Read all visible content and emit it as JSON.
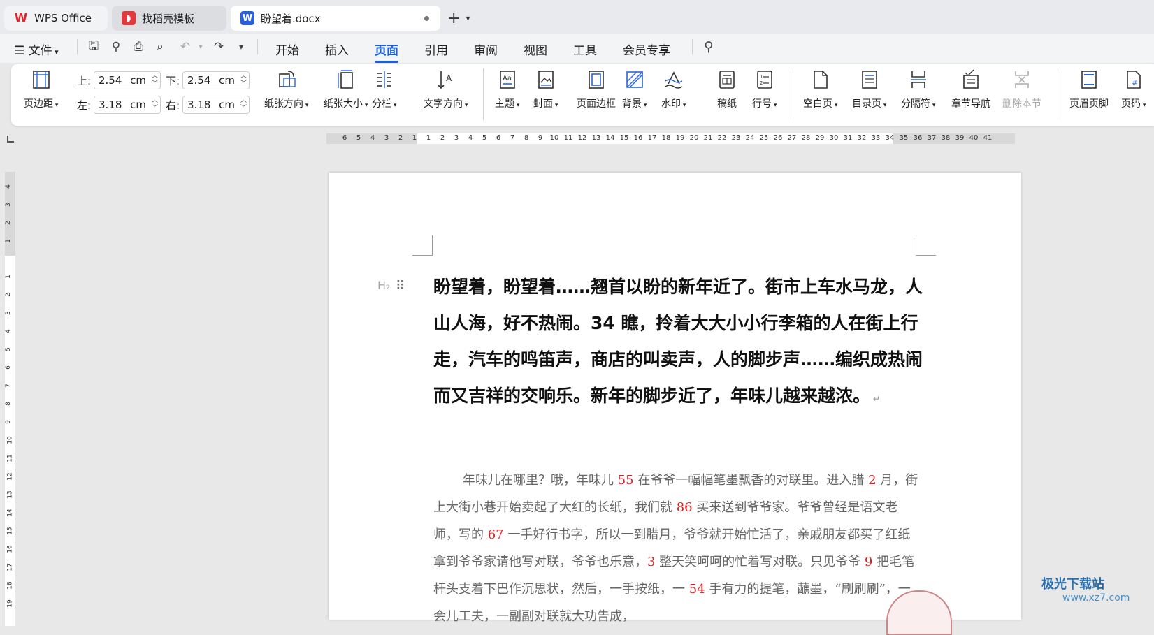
{
  "tabs": [
    {
      "label": "WPS Office"
    },
    {
      "label": "找稻壳模板"
    },
    {
      "label": "盼望着.docx"
    }
  ],
  "menu": {
    "file": "文件",
    "items": [
      "开始",
      "插入",
      "页面",
      "引用",
      "审阅",
      "视图",
      "工具",
      "会员专享"
    ],
    "active": "页面"
  },
  "margins": {
    "top_label": "上:",
    "top_value": "2.54",
    "bottom_label": "下:",
    "bottom_value": "2.54",
    "left_label": "左:",
    "left_value": "3.18",
    "right_label": "右:",
    "right_value": "3.18",
    "unit": "cm"
  },
  "ribbon": {
    "margin": "页边距",
    "orientation": "纸张方向",
    "size": "纸张大小",
    "columns": "分栏",
    "text_direction": "文字方向",
    "theme": "主题",
    "cover": "封面",
    "page_border": "页面边框",
    "background": "背景",
    "watermark": "水印",
    "manuscript": "稿纸",
    "line_number": "行号",
    "blank_page": "空白页",
    "toc_page": "目录页",
    "separator": "分隔符",
    "chapter_nav": "章节导航",
    "delete_section": "删除本节",
    "header_footer": "页眉页脚",
    "page_number": "页码"
  },
  "ruler": {
    "h_ticks": [
      "6",
      "5",
      "4",
      "3",
      "2",
      "1",
      "1",
      "2",
      "3",
      "4",
      "5",
      "6",
      "7",
      "8",
      "9",
      "10",
      "11",
      "12",
      "13",
      "14",
      "15",
      "16",
      "17",
      "18",
      "19",
      "20",
      "21",
      "22",
      "23",
      "24",
      "25",
      "26",
      "27",
      "28",
      "29",
      "30",
      "31",
      "32",
      "33",
      "34",
      "35",
      "36",
      "37",
      "38",
      "39",
      "40",
      "41"
    ],
    "v_ticks": [
      "4",
      "3",
      "2",
      "1",
      "1",
      "2",
      "3",
      "4",
      "5",
      "6",
      "7",
      "8",
      "9",
      "10",
      "11",
      "12",
      "13",
      "14",
      "15",
      "16",
      "17",
      "18",
      "19"
    ]
  },
  "document": {
    "style_marker": "H₂",
    "heading": "盼望着，盼望着……翘首以盼的新年近了。街市上车水马龙，人山人海，好不热闹。34 瞧，拎着大大小小行李箱的人在街上行走，汽车的鸣笛声，商店的叫卖声，人的脚步声……编织成热闹而又吉祥的交响乐。新年的脚步近了，年味儿越来越浓。",
    "para": {
      "s1": "年味儿在哪里？哦，年味儿 ",
      "n1": "55",
      "s2": " 在爷爷一幅幅笔墨飘香的对联里。进入腊 ",
      "n2": "2",
      "s3": " 月，街上大街小巷开始卖起了大红的长纸，我们就 ",
      "n3": "86",
      "s4": " 买来送到爷爷家。爷爷曾经是语文老师，写的 ",
      "n4": "67",
      "s5": " 一手好行书字，所以一到腊月，爷爷就开始忙活了，亲戚朋友都买了红纸拿到爷爷家请他写对联，爷爷也乐意，",
      "n5": "3",
      "s6": " 整天笑呵呵的忙着写对联。只见爷爷 ",
      "n6": "9",
      "s7": " 把毛笔杆头支着下巴作沉思状，然后，一手按纸，一 ",
      "n7": "54",
      "s8": " 手有力的提笔，蘸墨，“刷刷刷”，一会儿工夫，一副副对联就大功告成，"
    }
  },
  "watermark": {
    "main": "极光下载站",
    "sub": "www.xz7.com"
  }
}
